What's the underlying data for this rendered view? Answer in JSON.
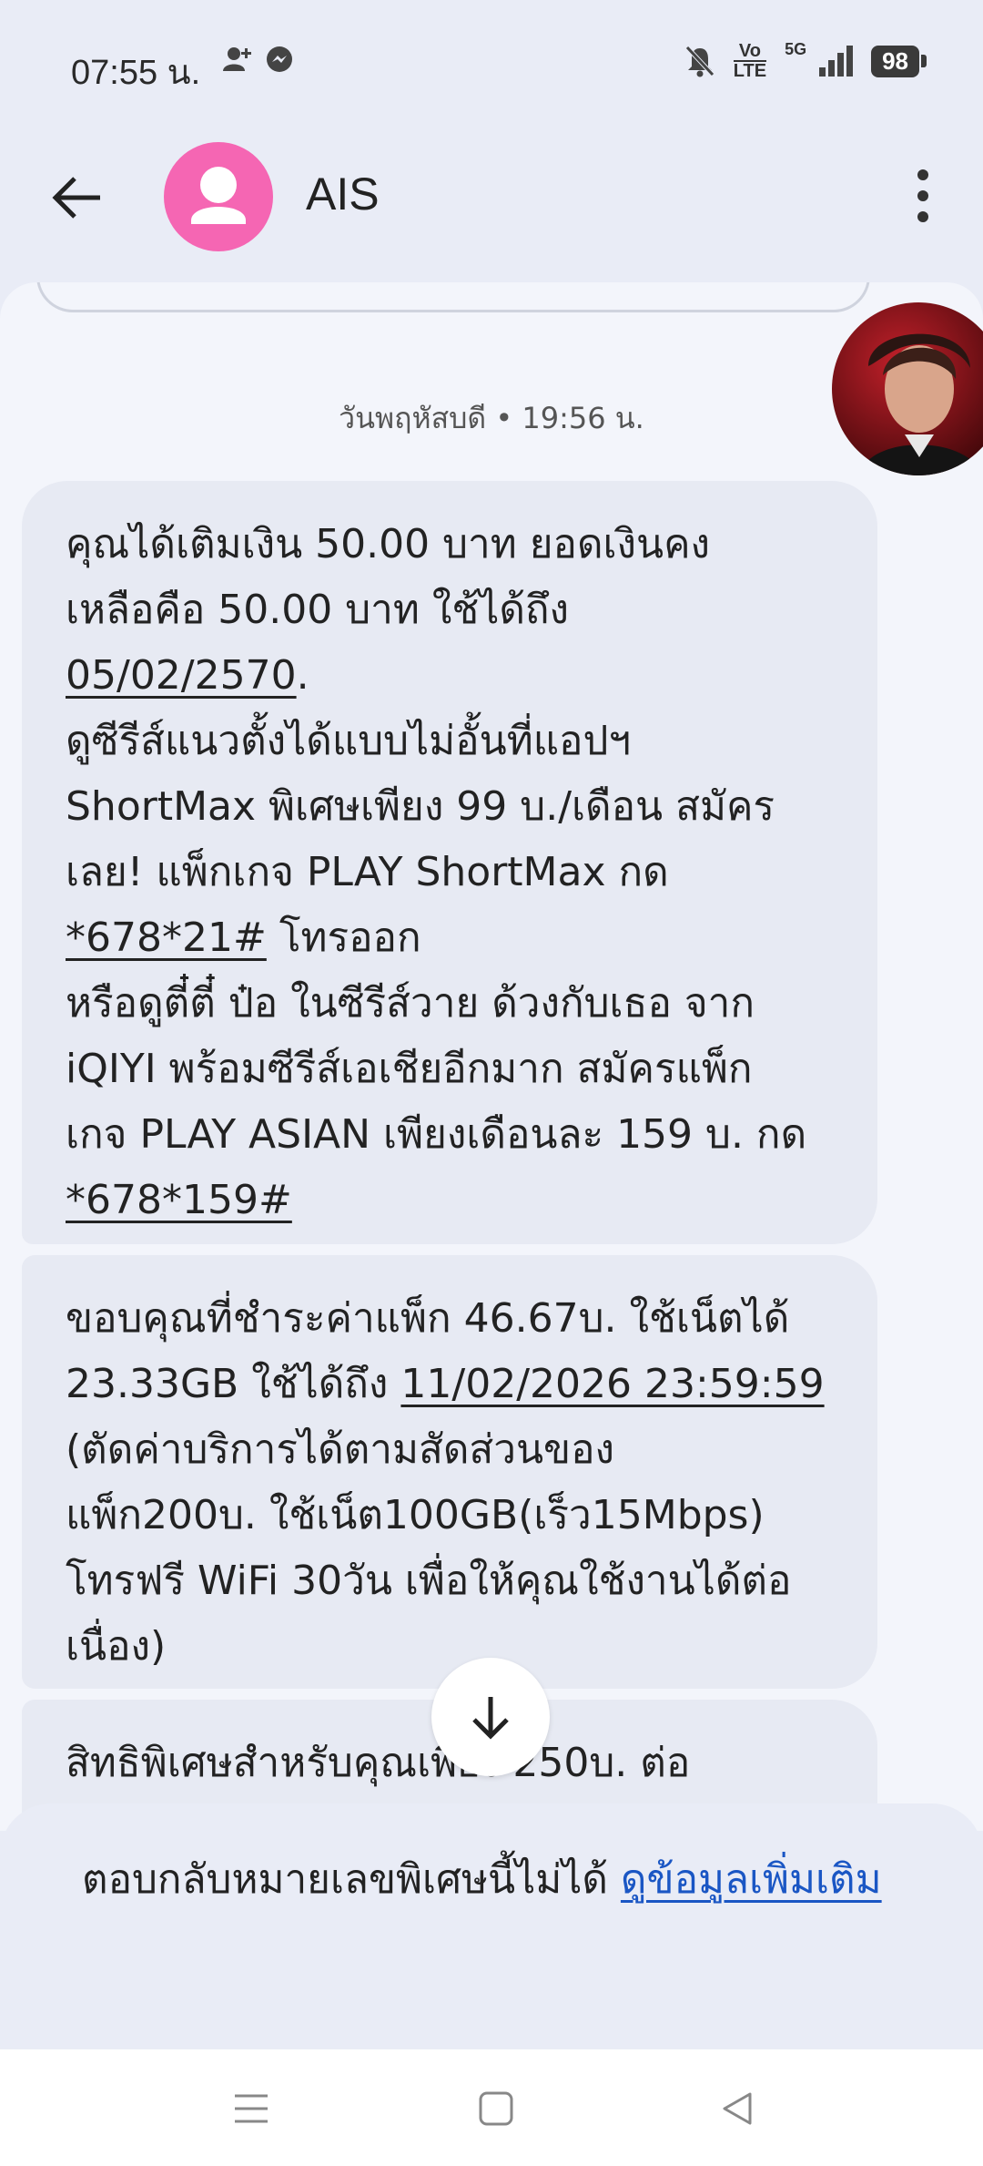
{
  "status": {
    "time": "07:55 น.",
    "network_top": "Vo",
    "network_bottom": "LTE",
    "signal_label": "5G",
    "battery": "98"
  },
  "header": {
    "contact_name": "AIS"
  },
  "conversation": {
    "date_separator": "วันพฤหัสบดี • 19:56 น.",
    "message1": {
      "lines": [
        "คุณได้เติมเงิน 50.00 บาท ยอดเงินคง",
        "เหลือคือ 50.00 บาท ใช้ได้ถึง",
        "05/02/2570",
        ".",
        "ดูซีรีส์แนวตั้งได้แบบไม่อั้นที่แอปฯ",
        "ShortMax พิเศษเพียง 99 บ./เดือน สมัคร",
        "เลย! แพ็กเกจ PLAY ShortMax กด",
        "*678*21#",
        " โทรออก",
        "หรือดูตี๋ตี๋ ป๋อ ในซีรีส์วาย ด้วงกับเธอ จาก",
        "iQIYI พร้อมซีรีส์เอเชียอีกมาก สมัครแพ็ก",
        "เกจ PLAY ASIAN เพียงเดือนละ 159 บ. กด",
        "*678*159#"
      ]
    },
    "message2": {
      "lines": [
        "ขอบคุณที่ชำระค่าแพ็ก 46.67บ. ใช้เน็ตได้",
        "23.33GB ใช้ได้ถึง ",
        "11/02/2026 23:59:59",
        "(ตัดค่าบริการได้ตามสัดส่วนของ",
        "แพ็ก200บ. ใช้เน็ต100GB(เร็ว15Mbps)",
        "โทรฟรี WiFi 30วัน เพื่อให้คุณใช้งานได้ต่อ",
        "เนื่อง)"
      ]
    },
    "message3": {
      "lines": [
        "สิทธิพิเศษสำหรับคุณเพียง 250บ. ต่อ"
      ]
    }
  },
  "reply_notice": {
    "text": "ตอบกลับหมายเลขพิเศษนี้ไม่ได้ ",
    "link": "ดูข้อมูลเพิ่มเติม"
  },
  "colors": {
    "background": "#e9ecf6",
    "bubble": "#e7eaf3",
    "avatar": "#f566b3",
    "link": "#1a56c4"
  }
}
